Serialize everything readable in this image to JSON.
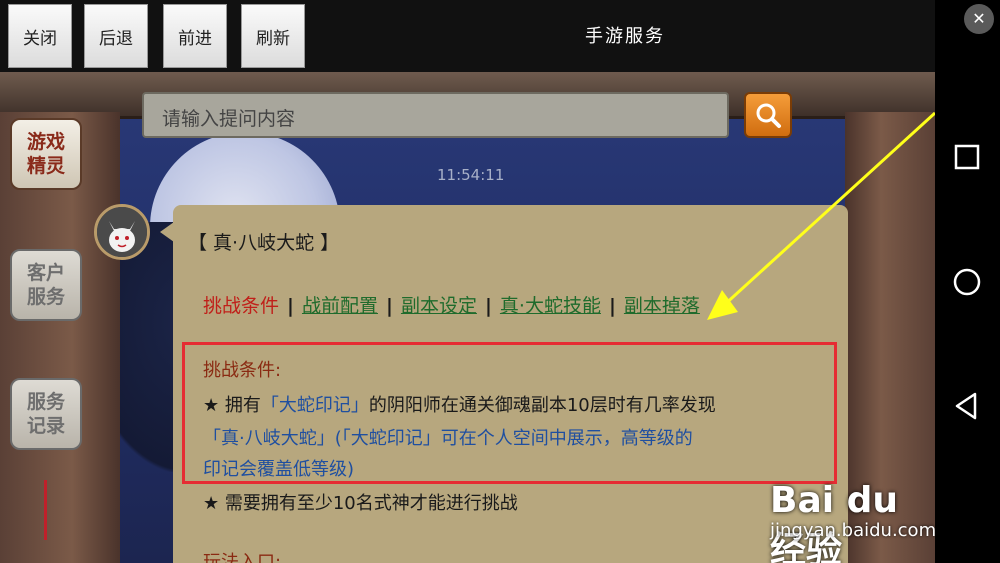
{
  "toolbar": {
    "close_label": "关闭",
    "back_label": "后退",
    "forward_label": "前进",
    "refresh_label": "刷新",
    "title": "手游服务"
  },
  "search": {
    "placeholder": "请输入提问内容",
    "button_icon": "search-icon"
  },
  "sidebar": {
    "items": [
      {
        "label": "游戏精灵",
        "active": true
      },
      {
        "label": "客户服务",
        "active": false
      },
      {
        "label": "服务记录",
        "active": false
      }
    ]
  },
  "chat": {
    "timestamp": "11:54:11",
    "message": {
      "title": "【 真·八岐大蛇 】",
      "tabs": [
        "挑战条件",
        "战前配置",
        "副本设定",
        "真·大蛇技能",
        "副本掉落"
      ],
      "condition_heading": "挑战条件:",
      "line1_prefix": "★ 拥有",
      "line1_blue": "「大蛇印记」",
      "line1_suffix": "的阴阳师在通关御魂副本10层时有几率发现",
      "line2": "「真·八岐大蛇」(「大蛇印记」可在个人空间中展示，高等级的",
      "line3": "印记会覆盖低等级)",
      "line4": "★ 需要拥有至少10名式神才能进行挑战",
      "cut_heading": "玩法入口:"
    }
  },
  "watermark": {
    "brand": "Bai du 经验",
    "url": "jingyan.baidu.com"
  },
  "colors": {
    "accent_red": "#e62c33",
    "arrow_yellow": "#ffff1a",
    "link_green": "#1f6b2c",
    "bubble_bg": "#b7a77e"
  }
}
